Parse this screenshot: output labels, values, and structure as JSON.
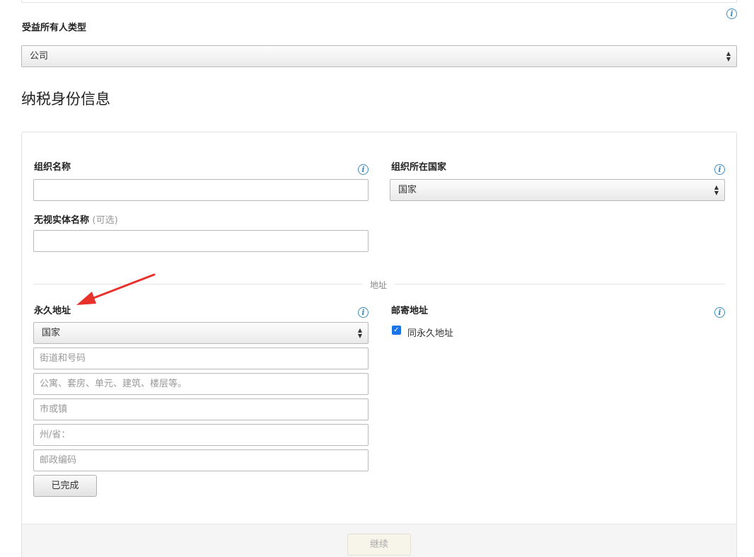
{
  "owner_type": {
    "label": "受益所有人类型",
    "selected": "公司"
  },
  "tax_section": {
    "title": "纳税身份信息"
  },
  "org": {
    "name_label": "组织名称",
    "country_label": "组织所在国家",
    "country_selected": "国家",
    "disregarded_label": "无视实体名称",
    "disregarded_optional": "(可选)"
  },
  "address": {
    "divider_label": "地址",
    "permanent_label": "永久地址",
    "country_selected": "国家",
    "street_placeholder": "街道和号码",
    "apt_placeholder": "公寓、套房、单元、建筑、楼层等。",
    "city_placeholder": "市或镇",
    "state_placeholder": "州/省：",
    "zip_placeholder": "邮政编码",
    "done_label": "已完成",
    "mailing_label": "邮寄地址",
    "same_as_permanent": "同永久地址",
    "same_checked": true
  },
  "footer": {
    "continue_label": "继续"
  },
  "icons": {
    "info": "i",
    "checkbox_check": "✓",
    "select_arrows": "▲▼"
  },
  "colors": {
    "info_accent": "#3f8bbf",
    "checkbox": "#1a73e8",
    "arrow": "#e8312a"
  }
}
